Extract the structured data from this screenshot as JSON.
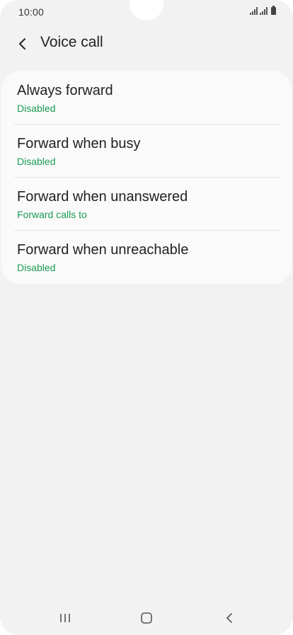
{
  "status_bar": {
    "time": "10:00",
    "icons": [
      "signal-icon",
      "signal-icon",
      "battery-icon"
    ]
  },
  "header": {
    "title": "Voice call",
    "back_icon": "chevron-left-icon"
  },
  "settings": {
    "items": [
      {
        "title": "Always forward",
        "subtitle": "Disabled"
      },
      {
        "title": "Forward when busy",
        "subtitle": "Disabled"
      },
      {
        "title": "Forward when unanswered",
        "subtitle": "Forward calls to"
      },
      {
        "title": "Forward when unreachable",
        "subtitle": "Disabled"
      }
    ]
  },
  "nav_bar": {
    "buttons": [
      "recent-apps-icon",
      "home-icon",
      "back-icon"
    ]
  },
  "colors": {
    "background": "#f2f2f2",
    "card": "#fafafa",
    "accent_green": "#1a9b52",
    "text_primary": "#222222"
  }
}
